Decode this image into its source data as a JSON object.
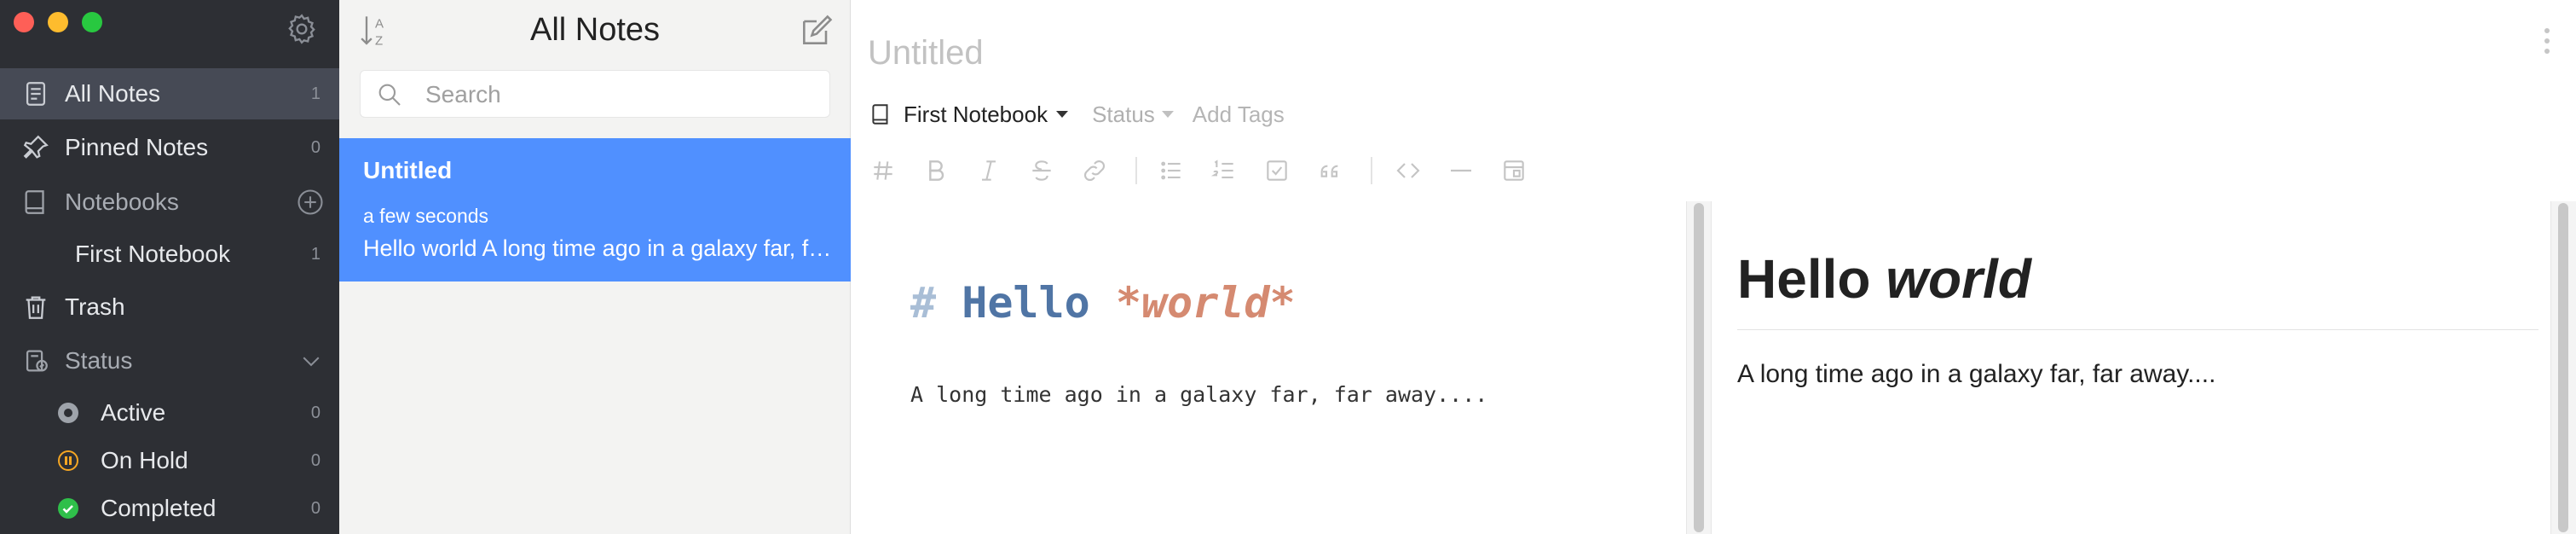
{
  "sidebar": {
    "items": [
      {
        "label": "All Notes",
        "count": "1"
      },
      {
        "label": "Pinned Notes",
        "count": "0"
      },
      {
        "label": "Notebooks"
      },
      {
        "label": "First Notebook",
        "count": "1"
      },
      {
        "label": "Trash"
      },
      {
        "label": "Status"
      }
    ],
    "statuses": [
      {
        "label": "Active",
        "count": "0",
        "color": "#9ea3aa"
      },
      {
        "label": "On Hold",
        "count": "0",
        "color": "#f5a623"
      },
      {
        "label": "Completed",
        "count": "0",
        "color": "#2fbf4a"
      }
    ]
  },
  "notelist": {
    "title": "All Notes",
    "search_placeholder": "Search",
    "notes": [
      {
        "title": "Untitled",
        "date": "a few seconds",
        "preview": "Hello world A long time ago in a galaxy far, far away...."
      }
    ]
  },
  "editor": {
    "title_placeholder": "Untitled",
    "notebook": "First Notebook",
    "status": "Status",
    "tags_placeholder": "Add Tags",
    "source": {
      "h1_hash": "#",
      "h1_word": "Hello",
      "h1_emph": "*world*",
      "paragraph": "A long time ago in a galaxy far, far away...."
    },
    "preview": {
      "h1_word": "Hello",
      "h1_emph": "world",
      "paragraph": "A long time ago in a galaxy far, far away...."
    }
  },
  "colors": {
    "sidebar_bg": "#2d2f34",
    "active_item_bg": "#464a55",
    "selected_note_bg": "#5090ff"
  }
}
